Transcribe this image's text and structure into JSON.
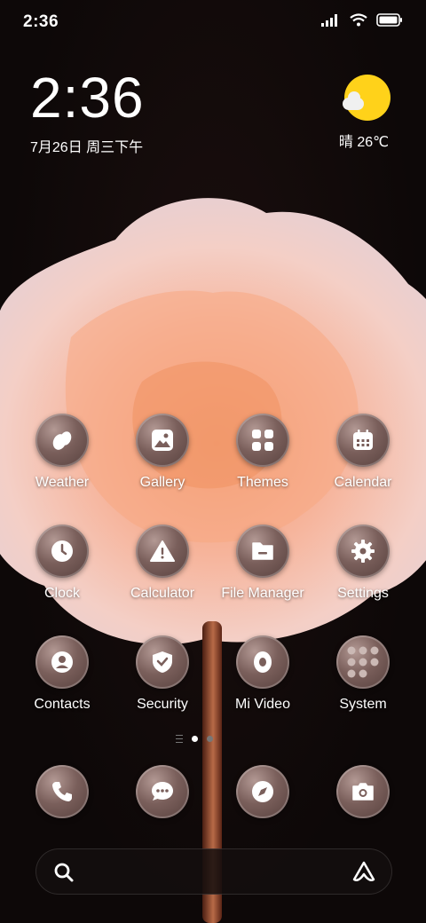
{
  "status_bar": {
    "time": "2:36"
  },
  "clock_widget": {
    "time": "2:36",
    "date": "7月26日 周三下午"
  },
  "weather_widget": {
    "text": "晴 26℃",
    "icon": "sun-cloud-icon"
  },
  "apps": [
    {
      "label": "Weather",
      "icon": "weather-icon"
    },
    {
      "label": "Gallery",
      "icon": "gallery-icon"
    },
    {
      "label": "Themes",
      "icon": "themes-icon"
    },
    {
      "label": "Calendar",
      "icon": "calendar-icon"
    },
    {
      "label": "Clock",
      "icon": "clock-icon"
    },
    {
      "label": "Calculator",
      "icon": "calculator-icon"
    },
    {
      "label": "File Manager",
      "icon": "file-manager-icon"
    },
    {
      "label": "Settings",
      "icon": "settings-icon"
    },
    {
      "label": "Contacts",
      "icon": "contacts-icon"
    },
    {
      "label": "Security",
      "icon": "security-icon"
    },
    {
      "label": "Mi Video",
      "icon": "mi-video-icon"
    },
    {
      "label": "System",
      "icon": "folder-icon"
    }
  ],
  "dock": [
    "phone-icon",
    "messages-icon",
    "browser-icon",
    "camera-icon"
  ],
  "search_bar": {
    "search_icon": "search-icon",
    "assistant_icon": "assistant-icon"
  },
  "colors": {
    "sun": "#ffd21a",
    "icon_bg": "#7a5f5b"
  }
}
